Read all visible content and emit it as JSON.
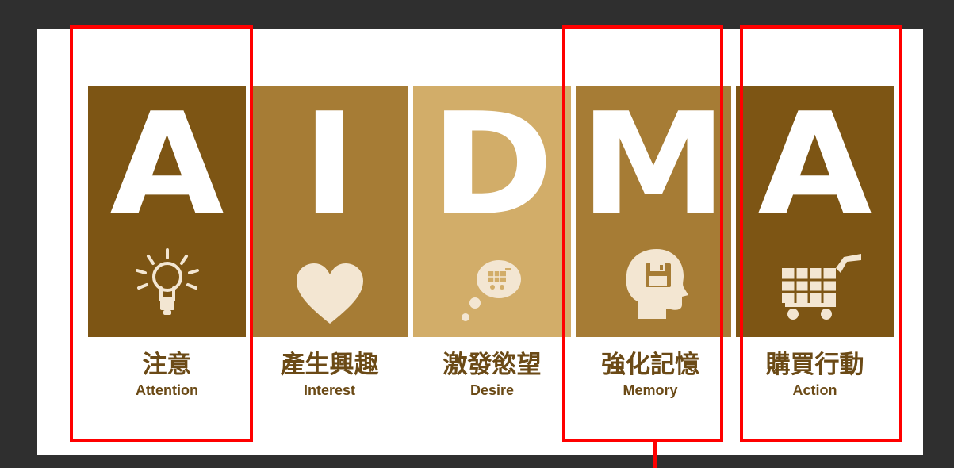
{
  "stages": [
    {
      "letter": "A",
      "zh": "注意",
      "en": "Attention",
      "icon": "lightbulb-icon",
      "color": "#7d5514"
    },
    {
      "letter": "I",
      "zh": "產生興趣",
      "en": "Interest",
      "icon": "heart-icon",
      "color": "#a67c35"
    },
    {
      "letter": "D",
      "zh": "激發慾望",
      "en": "Desire",
      "icon": "thought-cart-icon",
      "color": "#d2ad69"
    },
    {
      "letter": "M",
      "zh": "強化記憶",
      "en": "Memory",
      "icon": "head-floppy-icon",
      "color": "#a67c35"
    },
    {
      "letter": "A",
      "zh": "購買行動",
      "en": "Action",
      "icon": "shopping-cart-icon",
      "color": "#7d5514"
    }
  ],
  "highlighted_stages": [
    "Attention",
    "Memory",
    "Action"
  ],
  "highlight_color": "#ff0000",
  "label_color": "#6b4a16",
  "icon_color": "#f3e6d2"
}
